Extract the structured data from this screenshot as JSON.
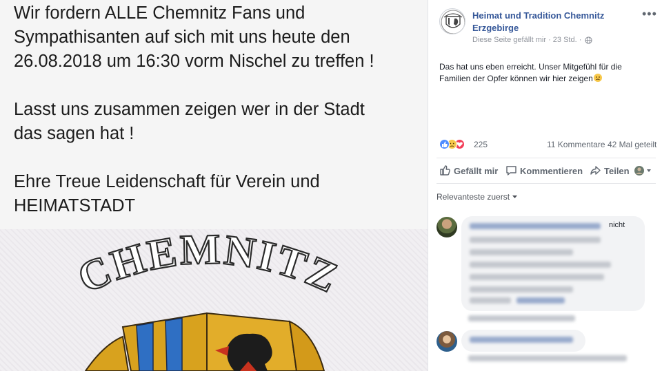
{
  "post_image": {
    "paragraphs": [
      [
        "Wir fordern ALLE Chemnitz Fans und",
        "Sympathisanten auf sich mit uns heute den",
        "26.08.2018 um 16:30 vorm Nischel zu treffen !"
      ],
      [
        "Lasst uns zusammen zeigen wer in der Stadt",
        "das sagen hat !"
      ],
      [
        "Ehre Treue Leidenschaft für Verein und",
        "HEIMATSTADT"
      ]
    ],
    "emblem_text": "CHEMNITZ"
  },
  "page": {
    "name": "Heimat und Tradition Chemnitz Erzgebirge",
    "liked_label": "Diese Seite gefällt mir",
    "separator": "·",
    "time": "23 Std.",
    "separator2": "·",
    "privacy_icon": "globe-icon",
    "more_icon": "•••"
  },
  "post": {
    "text": "Das hat uns eben erreicht. Unser Mitgefühl für die Familien der Opfer können wir hier zeigen",
    "emoji_icon": "sad-face-icon"
  },
  "reactions": {
    "icons": [
      "like-reaction-icon",
      "sad-reaction-icon",
      "love-reaction-icon"
    ],
    "count": "225",
    "comments": "11 Kommentare",
    "shares": "42 Mal geteilt"
  },
  "actions": {
    "like_label": "Gefällt mir",
    "comment_label": "Kommentieren",
    "share_label": "Teilen"
  },
  "comments_section": {
    "sort_label": "Relevanteste zuerst",
    "comment1_visible_fragment": "nicht"
  },
  "colors": {
    "link": "#365899",
    "meta": "#90949c",
    "text": "#1d2129",
    "like_blue": "#4f8dff",
    "love_red": "#f33e58",
    "sad_yellow": "#f7c84a",
    "bubble": "#f2f3f5"
  }
}
